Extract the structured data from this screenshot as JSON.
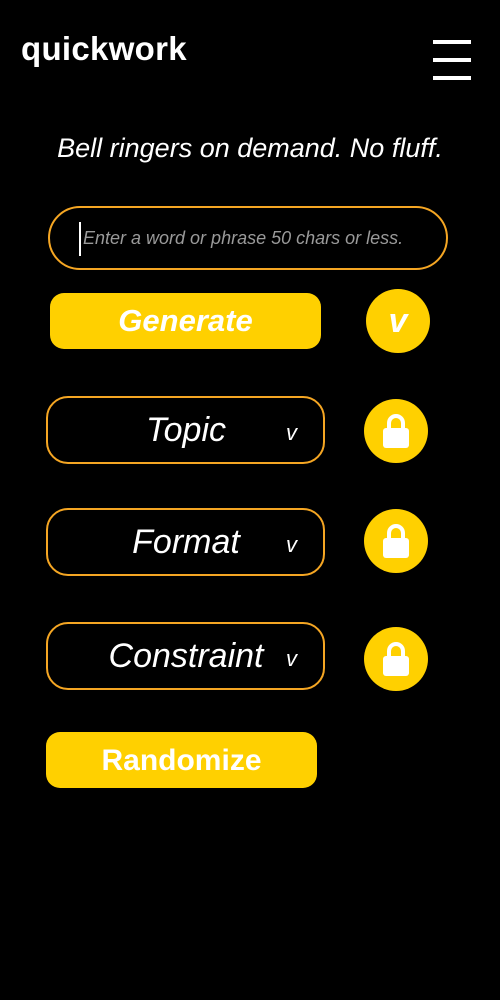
{
  "app": {
    "logo": "quickwork",
    "menu_icon": "hamburger-menu-icon"
  },
  "tagline": "Bell ringers on demand. No fluff.",
  "search": {
    "value": "",
    "placeholder": "Enter a word or phrase 50 chars or less."
  },
  "actions": {
    "generate_label": "Generate",
    "expand_label": "v",
    "randomize_label": "Randomize"
  },
  "selectors": [
    {
      "label": "Topic",
      "chevron": "v",
      "lock_icon": "lock-icon"
    },
    {
      "label": "Format",
      "chevron": "v",
      "lock_icon": "lock-icon"
    },
    {
      "label": "Constraint",
      "chevron": "v",
      "lock_icon": "lock-icon"
    }
  ],
  "colors": {
    "background": "#000000",
    "accent": "#ffd000",
    "border": "#f5a623",
    "text": "#ffffff"
  }
}
